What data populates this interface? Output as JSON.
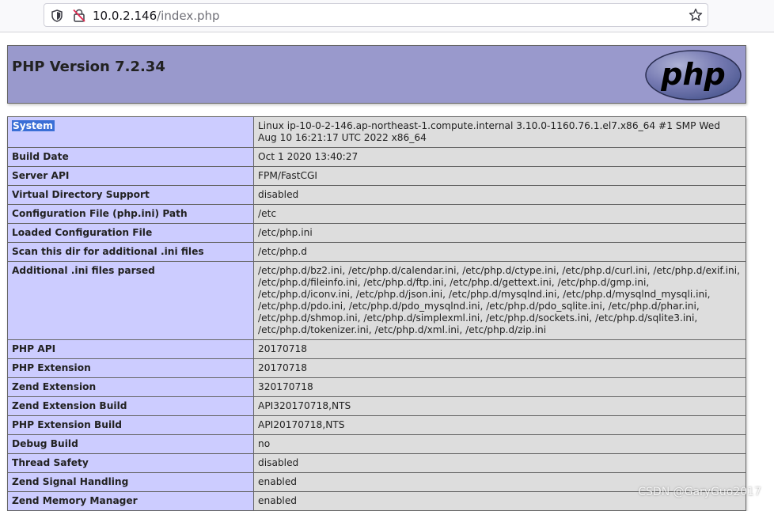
{
  "browser": {
    "url_host": "10.0.2.146",
    "url_path": "/index.php",
    "icons": {
      "tracking": "shield-icon",
      "security": "lock-warning-icon",
      "bookmark": "star-icon"
    }
  },
  "header": {
    "title": "PHP Version 7.2.34",
    "logo_text": "php",
    "bg_color": "#9999cc"
  },
  "rows": [
    {
      "key": "System",
      "value": "Linux ip-10-0-2-146.ap-northeast-1.compute.internal 3.10.0-1160.76.1.el7.x86_64 #1 SMP Wed Aug 10 16:21:17 UTC 2022 x86_64"
    },
    {
      "key": "Build Date",
      "value": "Oct 1 2020 13:40:27"
    },
    {
      "key": "Server API",
      "value": "FPM/FastCGI"
    },
    {
      "key": "Virtual Directory Support",
      "value": "disabled"
    },
    {
      "key": "Configuration File (php.ini) Path",
      "value": "/etc"
    },
    {
      "key": "Loaded Configuration File",
      "value": "/etc/php.ini"
    },
    {
      "key": "Scan this dir for additional .ini files",
      "value": "/etc/php.d"
    },
    {
      "key": "Additional .ini files parsed",
      "value": "/etc/php.d/bz2.ini, /etc/php.d/calendar.ini, /etc/php.d/ctype.ini, /etc/php.d/curl.ini, /etc/php.d/exif.ini, /etc/php.d/fileinfo.ini, /etc/php.d/ftp.ini, /etc/php.d/gettext.ini, /etc/php.d/gmp.ini, /etc/php.d/iconv.ini, /etc/php.d/json.ini, /etc/php.d/mysqlnd.ini, /etc/php.d/mysqlnd_mysqli.ini, /etc/php.d/pdo.ini, /etc/php.d/pdo_mysqlnd.ini, /etc/php.d/pdo_sqlite.ini, /etc/php.d/phar.ini, /etc/php.d/shmop.ini, /etc/php.d/simplexml.ini, /etc/php.d/sockets.ini, /etc/php.d/sqlite3.ini, /etc/php.d/tokenizer.ini, /etc/php.d/xml.ini, /etc/php.d/zip.ini"
    },
    {
      "key": "PHP API",
      "value": "20170718"
    },
    {
      "key": "PHP Extension",
      "value": "20170718"
    },
    {
      "key": "Zend Extension",
      "value": "320170718"
    },
    {
      "key": "Zend Extension Build",
      "value": "API320170718,NTS"
    },
    {
      "key": "PHP Extension Build",
      "value": "API20170718,NTS"
    },
    {
      "key": "Debug Build",
      "value": "no"
    },
    {
      "key": "Thread Safety",
      "value": "disabled"
    },
    {
      "key": "Zend Signal Handling",
      "value": "enabled"
    },
    {
      "key": "Zend Memory Manager",
      "value": "enabled"
    }
  ],
  "watermark": "CSDN @GaryGuo2017",
  "colors": {
    "key_cell": "#ccccff",
    "value_cell": "#dddddd",
    "selection": "#3a6fd6"
  }
}
